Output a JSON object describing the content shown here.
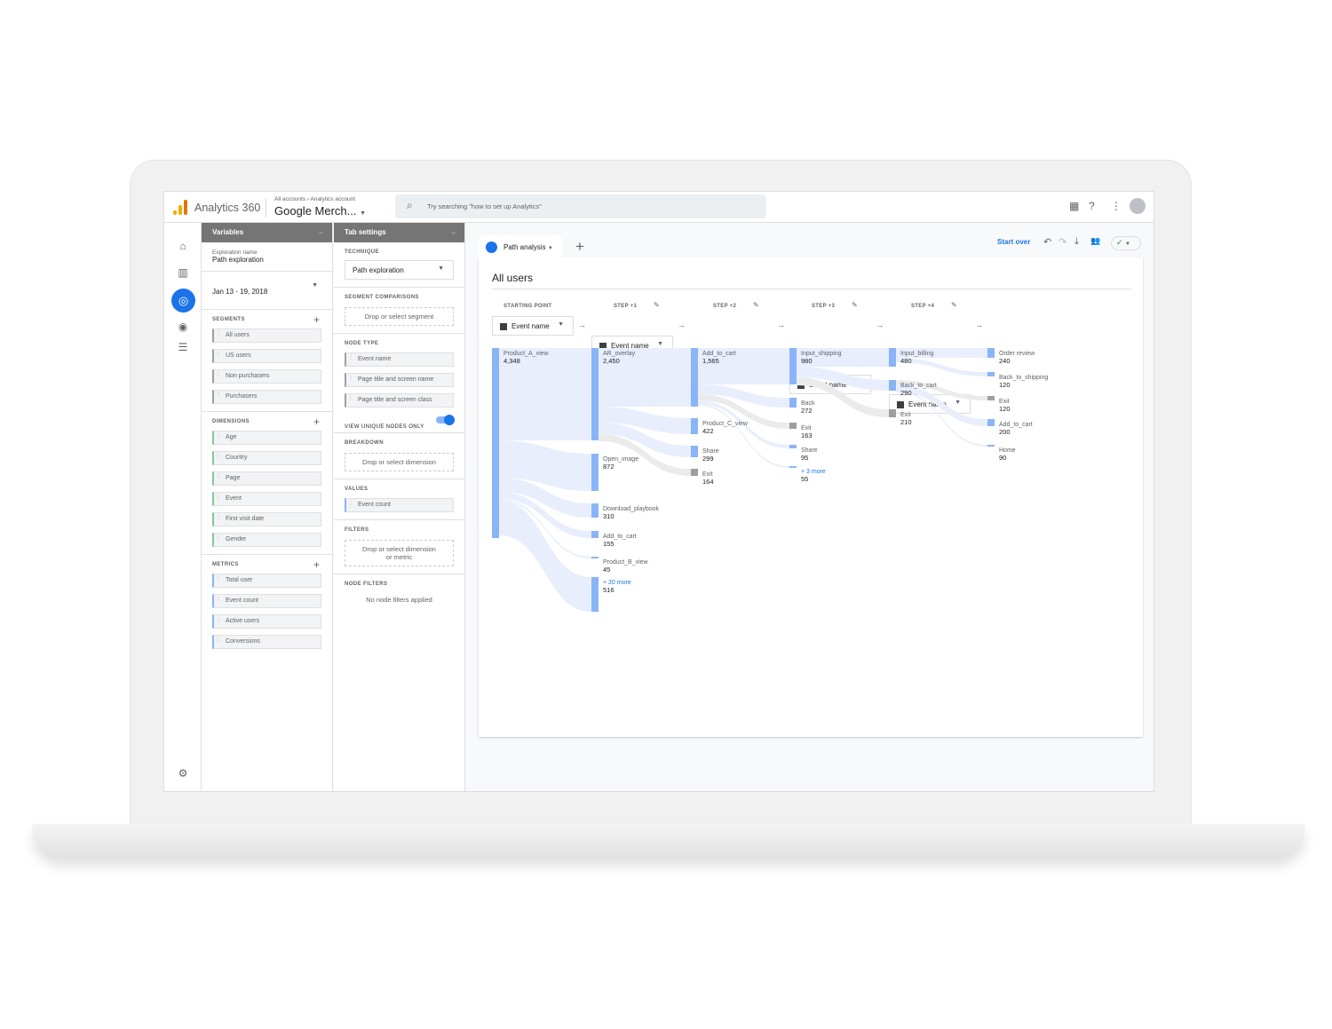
{
  "app": {
    "brand": "Analytics 360",
    "breadcrumb": "All accounts  ›  Analytics account",
    "account": "Google Merch...",
    "search_placeholder": "Try searching \"how to set up Analytics\""
  },
  "variables": {
    "title": "Variables",
    "exploration_label": "Exploration name",
    "exploration_name": "Path exploration",
    "date_range": "Jan 13 - 19, 2018",
    "segments_label": "SEGMENTS",
    "segments": [
      "All users",
      "US users",
      "Non purchasers",
      "Purchasers"
    ],
    "dimensions_label": "DIMENSIONS",
    "dimensions": [
      "Age",
      "Country",
      "Page",
      "Event",
      "First visit date",
      "Gender"
    ],
    "metrics_label": "METRICS",
    "metrics": [
      "Total user",
      "Event count",
      "Active users",
      "Conversions"
    ]
  },
  "tab_settings": {
    "title": "Tab settings",
    "technique_label": "TECHNIQUE",
    "technique": "Path exploration",
    "segment_comparisons_label": "SEGMENT COMPARISONS",
    "segment_drop": "Drop or select segment",
    "node_type_label": "NODE TYPE",
    "node_types": [
      "Event name",
      "Page title and screen name",
      "Page title and screen class"
    ],
    "unique_nodes_label": "VIEW UNIQUE NODES ONLY",
    "unique_nodes_on": true,
    "breakdown_label": "BREAKDOWN",
    "breakdown_drop": "Drop or select dimension",
    "values_label": "VALUES",
    "value": "Event count",
    "filters_label": "FILTERS",
    "filters_drop": "Drop or select dimension or metric",
    "node_filters_label": "NODE FILTERS",
    "node_filters": "No node filters applied"
  },
  "toolbar": {
    "tab": "Path analysis",
    "start_over": "Start over"
  },
  "report": {
    "title": "All users",
    "steps": [
      {
        "label": "STARTING POINT",
        "type": "Event name"
      },
      {
        "label": "STEP +1",
        "type": "Event name"
      },
      {
        "label": "STEP +2",
        "type": "Event name"
      },
      {
        "label": "STEP +3",
        "type": "Event name"
      },
      {
        "label": "STEP +4",
        "type": "Event name"
      }
    ]
  },
  "colors": {
    "accent": "#1a73e8",
    "node": "#8ab4f8",
    "exit": "#9e9e9e",
    "flow": "#e8eefc",
    "exit_flow": "#ebebeb"
  },
  "path_data": [
    [
      {
        "label": "Product_A_view",
        "value": "4,348"
      }
    ],
    [
      {
        "label": "AR_overlay",
        "value": "2,450",
        "from": 0
      },
      {
        "label": "Open_image",
        "value": "872",
        "from": 0
      },
      {
        "label": "Download_playbook",
        "value": "310",
        "from": 0
      },
      {
        "label": "Add_to_cart",
        "value": "155",
        "from": 0
      },
      {
        "label": "Product_B_view",
        "value": "45",
        "from": 0
      },
      {
        "label": "+ 20 more",
        "value": "516",
        "from": 0,
        "more": true
      }
    ],
    [
      {
        "label": "Add_to_cart",
        "value": "1,565",
        "from": 0
      },
      {
        "label": "Product_C_view",
        "value": "422",
        "from": 0
      },
      {
        "label": "Share",
        "value": "299",
        "from": 0
      },
      {
        "label": "Exit",
        "value": "164",
        "from": 0,
        "exit": true
      }
    ],
    [
      {
        "label": "Input_shipping",
        "value": "980",
        "from": 0
      },
      {
        "label": "Back",
        "value": "272",
        "from": 0
      },
      {
        "label": "Exit",
        "value": "163",
        "from": 0,
        "exit": true
      },
      {
        "label": "Share",
        "value": "95",
        "from": 0
      },
      {
        "label": "+ 3 more",
        "value": "55",
        "from": 0,
        "more": true
      }
    ],
    [
      {
        "label": "Input_billing",
        "value": "480",
        "from": 0
      },
      {
        "label": "Back_to_cart",
        "value": "290",
        "from": 0
      },
      {
        "label": "Exit",
        "value": "210",
        "from": 0,
        "exit": true
      }
    ],
    [
      {
        "label": "Order review",
        "value": "240",
        "from": 0
      },
      {
        "label": "Back_to_shipping",
        "value": "120",
        "from": 0
      },
      {
        "label": "Exit",
        "value": "120",
        "from": 1,
        "exit": true
      },
      {
        "label": "Add_to_cart",
        "value": "200",
        "from": 1
      },
      {
        "label": "Home",
        "value": "90",
        "from": 1
      }
    ]
  ]
}
